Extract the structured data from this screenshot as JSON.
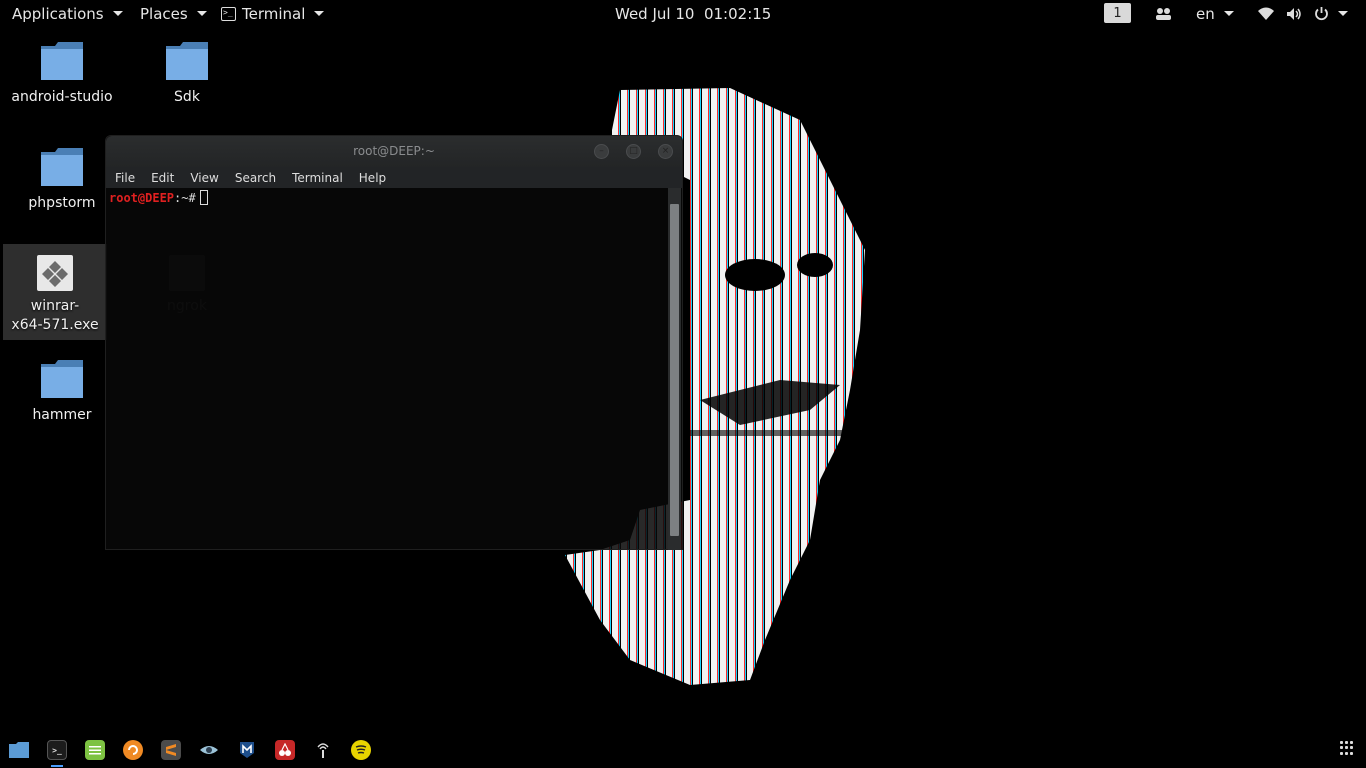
{
  "topbar": {
    "applications": "Applications",
    "places": "Places",
    "terminal": "Terminal",
    "clock": "Wed Jul 10  01:02:15",
    "workspace": "1",
    "language": "en",
    "icons": [
      "people-icon",
      "wifi-icon",
      "volume-icon",
      "power-icon"
    ]
  },
  "desktop": {
    "icons": [
      {
        "label": "android-studio",
        "type": "folder"
      },
      {
        "label": "Sdk",
        "type": "folder"
      },
      {
        "label": "phpstorm",
        "type": "folder"
      },
      {
        "label": "winrar-\nx64-571.exe",
        "type": "executable",
        "selected": true
      },
      {
        "label": "ngrok",
        "type": "executable"
      },
      {
        "label": "hammer",
        "type": "folder"
      }
    ]
  },
  "terminal": {
    "title": "root@DEEP:~",
    "menu": [
      "File",
      "Edit",
      "View",
      "Search",
      "Terminal",
      "Help"
    ],
    "prompt_user": "root@DEEP",
    "prompt_rest": ":~#",
    "colors": {
      "prompt": "#e02020",
      "background": "#080808"
    }
  },
  "dock": {
    "apps": [
      {
        "name": "files-icon",
        "color": "#5b9bd5"
      },
      {
        "name": "terminal-icon",
        "color": "#1c1c1c",
        "active": true
      },
      {
        "name": "text-editor-icon",
        "color": "#7dc242"
      },
      {
        "name": "burpsuite-icon",
        "color": "#f08a24"
      },
      {
        "name": "sublime-icon",
        "color": "#4b4b4b"
      },
      {
        "name": "eye-icon",
        "color": "#3e4a52"
      },
      {
        "name": "metasploit-icon",
        "color": "#1e4f8c"
      },
      {
        "name": "cherrytree-icon",
        "color": "#c62828"
      },
      {
        "name": "wifi-tool-icon",
        "color": "#2a2a2a"
      },
      {
        "name": "spotify-icon",
        "color": "#e8d400"
      }
    ]
  }
}
